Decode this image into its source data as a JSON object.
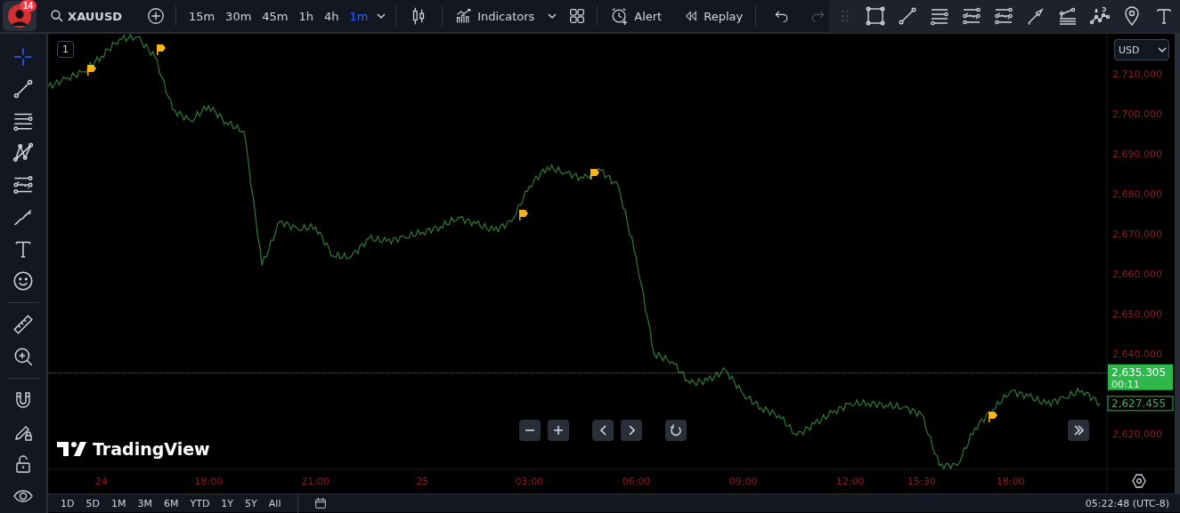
{
  "user": {
    "notifications": "14"
  },
  "symbol": "XAUUSD",
  "intervals": [
    {
      "label": "15m",
      "selected": false
    },
    {
      "label": "30m",
      "selected": false
    },
    {
      "label": "45m",
      "selected": false
    },
    {
      "label": "1h",
      "selected": false
    },
    {
      "label": "4h",
      "selected": false
    },
    {
      "label": "1m",
      "selected": true
    }
  ],
  "toolbar": {
    "indicators": "Indicators",
    "alert": "Alert",
    "replay": "Replay",
    "undo_disabled": false,
    "redo_disabled": true
  },
  "chart": {
    "pane_number": "1",
    "currency": "USD",
    "current_price": "2,635.305",
    "countdown": "00:11",
    "last_price": "2,627.455",
    "logo": "TradingView",
    "chart_data": {
      "type": "line",
      "ylim": [
        2611,
        2720
      ],
      "categories": [
        null,
        null,
        null,
        "24",
        null,
        null,
        null,
        null,
        null,
        "18:00",
        null,
        null,
        null,
        null,
        null,
        "21:00",
        null,
        null,
        null,
        null,
        null,
        "25",
        null,
        null,
        null,
        null,
        null,
        "03:00",
        null,
        null,
        null,
        null,
        null,
        "06:00",
        null,
        null,
        null,
        null,
        null,
        "09:00",
        null,
        null,
        null,
        null,
        null,
        "12:00",
        null,
        null,
        null,
        "15:30",
        null,
        null,
        null,
        null,
        "18:00",
        null,
        null,
        null,
        null,
        null
      ],
      "yticks": [
        {
          "value": 2620,
          "label": "2,620.000"
        },
        {
          "value": 2640,
          "label": "2,640.000"
        },
        {
          "value": 2650,
          "label": "2,650.000"
        },
        {
          "value": 2660,
          "label": "2,660.000"
        },
        {
          "value": 2670,
          "label": "2,670.000"
        },
        {
          "value": 2680,
          "label": "2,680.000"
        },
        {
          "value": 2690,
          "label": "2,690.000"
        },
        {
          "value": 2700,
          "label": "2,700.000"
        },
        {
          "value": 2710,
          "label": "2,710.000"
        }
      ],
      "series": [
        {
          "color": "#2e7d32",
          "values": [
            2706.7,
            2708.7,
            2710.6,
            2714.4,
            2718.7,
            2719.2,
            2714.2,
            2701,
            2698.2,
            2702,
            2697.8,
            2695.5,
            2662,
            2673,
            2671.2,
            2671.7,
            2664.4,
            2664.2,
            2668.8,
            2668.1,
            2669.1,
            2670.4,
            2671.7,
            2674,
            2672.5,
            2670.8,
            2673,
            2681.9,
            2686.7,
            2685.3,
            2683.8,
            2685.8,
            2681.8,
            2663.7,
            2639.9,
            2638,
            2632.6,
            2633.2,
            2635.9,
            2629.8,
            2626.4,
            2624.5,
            2619.5,
            2622.4,
            2625.2,
            2627.5,
            2627.6,
            2627.1,
            2626.5,
            2624.8,
            2612,
            2612,
            2621.4,
            2626,
            2630.6,
            2629.3,
            2627.4,
            2628.9,
            2630.8,
            2627.5
          ]
        }
      ]
    }
  },
  "range_buttons": [
    "1D",
    "5D",
    "1M",
    "3M",
    "6M",
    "YTD",
    "1Y",
    "5Y",
    "All"
  ],
  "clock": "05:22:48 (UTC-8)"
}
